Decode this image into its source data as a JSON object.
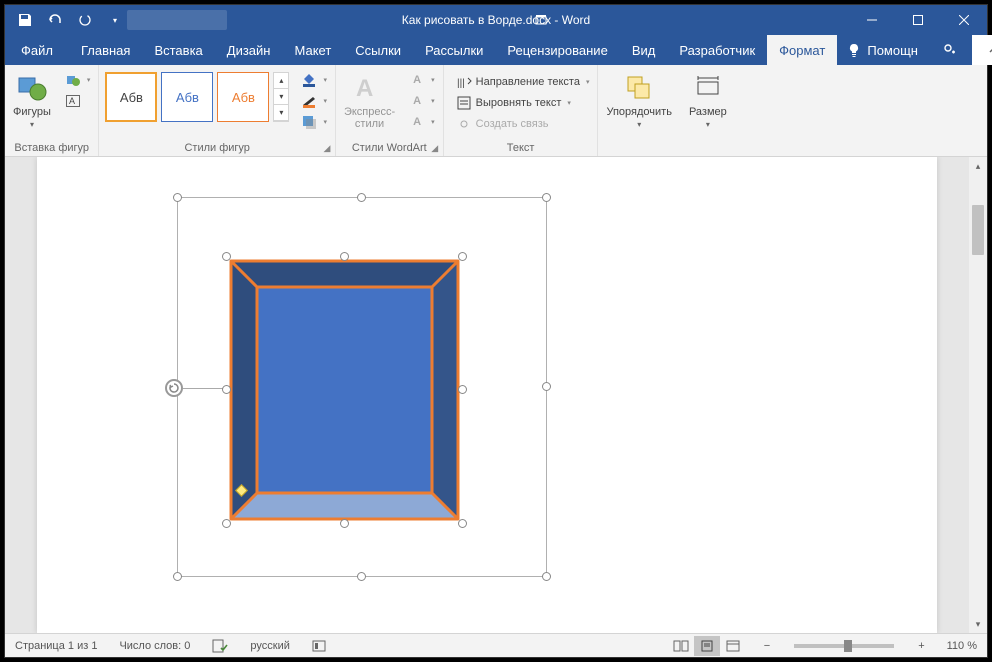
{
  "titlebar": {
    "document_title": "Как рисовать в Ворде.docx - Word"
  },
  "tabs": {
    "file": "Файл",
    "home": "Главная",
    "insert": "Вставка",
    "design": "Дизайн",
    "layout": "Макет",
    "references": "Ссылки",
    "mailings": "Рассылки",
    "review": "Рецензирование",
    "view": "Вид",
    "developer": "Разработчик",
    "format": "Формат",
    "tell_me": "Помощн"
  },
  "ribbon": {
    "insert_shapes": {
      "shapes": "Фигуры",
      "group_label": "Вставка фигур"
    },
    "shape_styles": {
      "sample_text": "Абв",
      "group_label": "Стили фигур"
    },
    "wordart": {
      "quick_styles": "Экспресс-\nстили",
      "group_label": "Стили WordArt"
    },
    "text": {
      "text_direction": "Направление текста",
      "align_text": "Выровнять текст",
      "create_link": "Создать связь",
      "group_label": "Текст"
    },
    "arrange": {
      "arrange": "Упорядочить",
      "size": "Размер"
    }
  },
  "statusbar": {
    "page": "Страница 1 из 1",
    "words": "Число слов: 0",
    "language": "русский",
    "zoom": "110 %"
  }
}
